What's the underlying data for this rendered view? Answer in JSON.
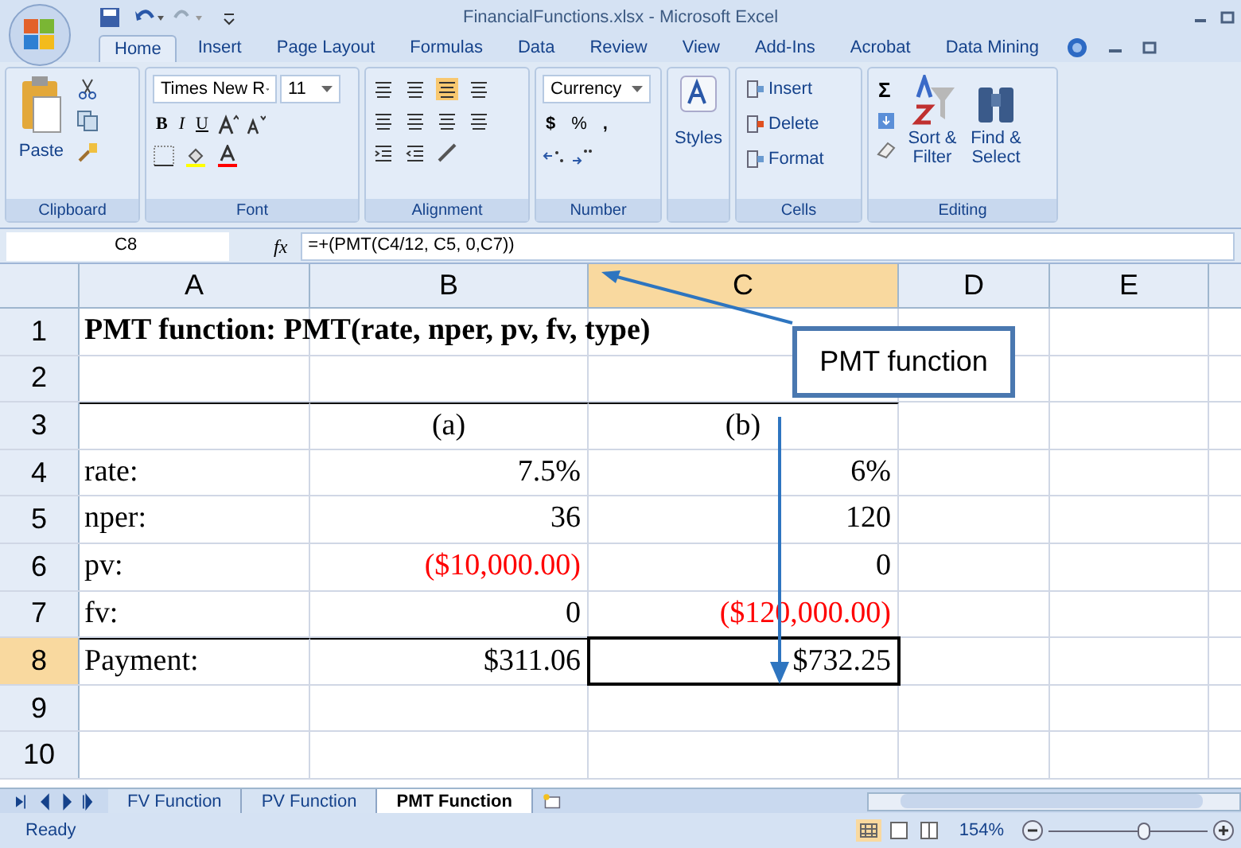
{
  "window": {
    "title": "FinancialFunctions.xlsx - Microsoft Excel"
  },
  "ribbon_tabs": [
    {
      "label": "Home",
      "selected": true
    },
    {
      "label": "Insert",
      "selected": false
    },
    {
      "label": "Page Layout",
      "selected": false
    },
    {
      "label": "Formulas",
      "selected": false
    },
    {
      "label": "Data",
      "selected": false
    },
    {
      "label": "Review",
      "selected": false
    },
    {
      "label": "View",
      "selected": false
    },
    {
      "label": "Add-Ins",
      "selected": false
    },
    {
      "label": "Acrobat",
      "selected": false
    },
    {
      "label": "Data Mining",
      "selected": false
    }
  ],
  "ribbon": {
    "paste": "Paste",
    "font_name": "Times New R",
    "font_size": "11",
    "bold": "B",
    "italic": "I",
    "underline": "U",
    "number_format": "Currency",
    "currency": "$",
    "percent": "%",
    "comma": ",",
    "styles": "Styles",
    "insert": "Insert",
    "delete": "Delete",
    "format": "Format",
    "sum": "Σ",
    "sort": "Sort & Filter",
    "find": "Find & Select",
    "group_labels": [
      "Clipboard",
      "Font",
      "Alignment",
      "Number",
      "Cells",
      "Editing"
    ]
  },
  "formula_bar": {
    "name_box": "C8",
    "fx": "fx",
    "formula": "=+(PMT(C4/12, C5, 0,C7))"
  },
  "columns": [
    {
      "label": "A",
      "selected": false
    },
    {
      "label": "B",
      "selected": false
    },
    {
      "label": "C",
      "selected": true
    },
    {
      "label": "D",
      "selected": false
    },
    {
      "label": "E",
      "selected": false
    }
  ],
  "rows": [
    {
      "number": "1",
      "selected": false,
      "cells": [
        {
          "kind": "title",
          "text": "PMT function: PMT(rate, nper, pv, fv, type)"
        }
      ]
    },
    {
      "number": "2",
      "selected": false,
      "cells": []
    },
    {
      "number": "3",
      "selected": false,
      "cells": [
        null,
        {
          "kind": "heading",
          "text": "(a)"
        },
        {
          "kind": "heading",
          "text": "(b)"
        }
      ]
    },
    {
      "number": "4",
      "selected": false,
      "cells": [
        {
          "kind": "text",
          "text": "rate:"
        },
        {
          "kind": "number",
          "text": "7.5%"
        },
        {
          "kind": "number",
          "text": "6%"
        }
      ]
    },
    {
      "number": "5",
      "selected": false,
      "cells": [
        {
          "kind": "text",
          "text": "nper:"
        },
        {
          "kind": "number",
          "text": "36"
        },
        {
          "kind": "number",
          "text": "120"
        }
      ]
    },
    {
      "number": "6",
      "selected": false,
      "cells": [
        {
          "kind": "text",
          "text": "pv:"
        },
        {
          "kind": "number",
          "text": "($10,000.00)",
          "color": "#ff0000"
        },
        {
          "kind": "number",
          "text": "0"
        }
      ]
    },
    {
      "number": "7",
      "selected": false,
      "cells": [
        {
          "kind": "text",
          "text": "fv:"
        },
        {
          "kind": "number",
          "text": "0"
        },
        {
          "kind": "number",
          "text": "($120,000.00)",
          "color": "#ff0000"
        }
      ]
    },
    {
      "number": "8",
      "selected": true,
      "cells": [
        {
          "kind": "text",
          "text": "Payment:"
        },
        {
          "kind": "number",
          "text": "$311.06"
        },
        {
          "kind": "number",
          "text": "$732.25",
          "selected": true
        }
      ]
    },
    {
      "number": "9",
      "selected": false,
      "cells": []
    },
    {
      "number": "10",
      "selected": false,
      "cells": []
    }
  ],
  "callout": {
    "text": "PMT function"
  },
  "sheet_tabs": [
    {
      "label": "FV Function",
      "selected": false
    },
    {
      "label": "PV Function",
      "selected": false
    },
    {
      "label": "PMT Function",
      "selected": true
    }
  ],
  "status_bar": {
    "status": "Ready",
    "zoom": "154%",
    "zoom_slider": {
      "level": 0.6
    }
  }
}
